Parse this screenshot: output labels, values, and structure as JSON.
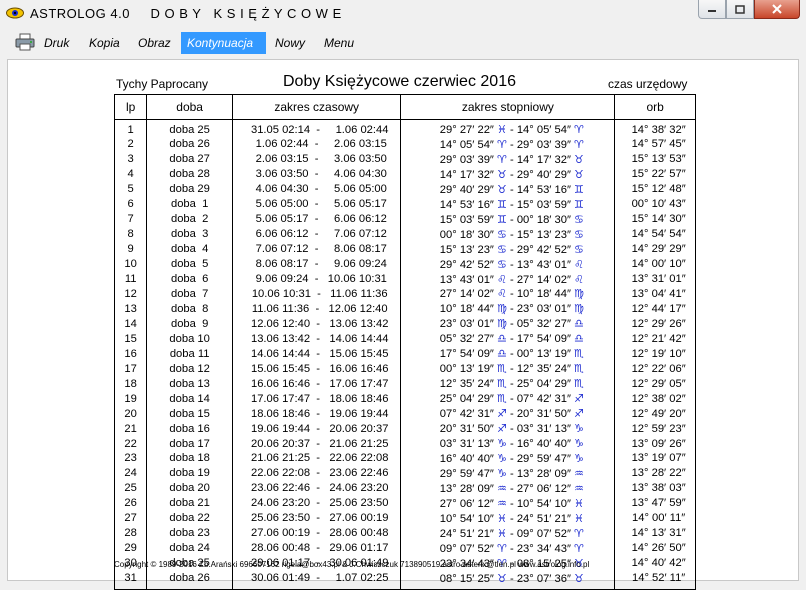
{
  "window": {
    "title": "ASTROLOG 4.0     D O B Y   K S I Ę Ż Y C O W E"
  },
  "menu": [
    "Druk",
    "Kopia",
    "Obraz",
    "Kontynuacja",
    "Nowy",
    "Menu"
  ],
  "active_menu": "Kontynuacja",
  "header": {
    "location": "Tychy Paprocany",
    "title": "Doby Księżycowe   czerwiec 2016",
    "timezone": "czas urzędowy"
  },
  "columns": {
    "lp": "lp",
    "doba": "doba",
    "time": "zakres czasowy",
    "deg": "zakres stopniowy",
    "orb": "orb"
  },
  "accent_color": "#3399ff",
  "rows": [
    {
      "lp": "1",
      "doba": "doba 25",
      "time": "31.05 02:14  -     1.06 02:44",
      "deg": "29° 27′ 22″",
      "s1": "♓",
      "deg2": "14° 05′ 54″",
      "s2": "♈",
      "orb": "14° 38′ 32″"
    },
    {
      "lp": "2",
      "doba": "doba 26",
      "time": " 1.06 02:44  -     2.06 03:15",
      "deg": "14° 05′ 54″",
      "s1": "♈",
      "deg2": "29° 03′ 39″",
      "s2": "♈",
      "orb": "14° 57′ 45″"
    },
    {
      "lp": "3",
      "doba": "doba 27",
      "time": " 2.06 03:15  -     3.06 03:50",
      "deg": "29° 03′ 39″",
      "s1": "♈",
      "deg2": "14° 17′ 32″",
      "s2": "♉",
      "orb": "15° 13′ 53″"
    },
    {
      "lp": "4",
      "doba": "doba 28",
      "time": " 3.06 03:50  -     4.06 04:30",
      "deg": "14° 17′ 32″",
      "s1": "♉",
      "deg2": "29° 40′ 29″",
      "s2": "♉",
      "orb": "15° 22′ 57″"
    },
    {
      "lp": "5",
      "doba": "doba 29",
      "time": " 4.06 04:30  -     5.06 05:00",
      "deg": "29° 40′ 29″",
      "s1": "♉",
      "deg2": "14° 53′ 16″",
      "s2": "♊",
      "orb": "15° 12′ 48″"
    },
    {
      "lp": "6",
      "doba": "doba  1",
      "time": " 5.06 05:00  -     5.06 05:17",
      "deg": "14° 53′ 16″",
      "s1": "♊",
      "deg2": "15° 03′ 59″",
      "s2": "♊",
      "orb": "00° 10′ 43″"
    },
    {
      "lp": "7",
      "doba": "doba  2",
      "time": " 5.06 05:17  -     6.06 06:12",
      "deg": "15° 03′ 59″",
      "s1": "♊",
      "deg2": "00° 18′ 30″",
      "s2": "♋",
      "orb": "15° 14′ 30″"
    },
    {
      "lp": "8",
      "doba": "doba  3",
      "time": " 6.06 06:12  -     7.06 07:12",
      "deg": "00° 18′ 30″",
      "s1": "♋",
      "deg2": "15° 13′ 23″",
      "s2": "♋",
      "orb": "14° 54′ 54″"
    },
    {
      "lp": "9",
      "doba": "doba  4",
      "time": " 7.06 07:12  -     8.06 08:17",
      "deg": "15° 13′ 23″",
      "s1": "♋",
      "deg2": "29° 42′ 52″",
      "s2": "♋",
      "orb": "14° 29′ 29″"
    },
    {
      "lp": "10",
      "doba": "doba  5",
      "time": " 8.06 08:17  -     9.06 09:24",
      "deg": "29° 42′ 52″",
      "s1": "♋",
      "deg2": "13° 43′ 01″",
      "s2": "♌",
      "orb": "14° 00′ 10″"
    },
    {
      "lp": "11",
      "doba": "doba  6",
      "time": " 9.06 09:24  -   10.06 10:31",
      "deg": "13° 43′ 01″",
      "s1": "♌",
      "deg2": "27° 14′ 02″",
      "s2": "♌",
      "orb": "13° 31′ 01″"
    },
    {
      "lp": "12",
      "doba": "doba  7",
      "time": "10.06 10:31  -   11.06 11:36",
      "deg": "27° 14′ 02″",
      "s1": "♌",
      "deg2": "10° 18′ 44″",
      "s2": "♍",
      "orb": "13° 04′ 41″"
    },
    {
      "lp": "13",
      "doba": "doba  8",
      "time": "11.06 11:36  -   12.06 12:40",
      "deg": "10° 18′ 44″",
      "s1": "♍",
      "deg2": "23° 03′ 01″",
      "s2": "♍",
      "orb": "12° 44′ 17″"
    },
    {
      "lp": "14",
      "doba": "doba  9",
      "time": "12.06 12:40  -   13.06 13:42",
      "deg": "23° 03′ 01″",
      "s1": "♍",
      "deg2": "05° 32′ 27″",
      "s2": "♎",
      "orb": "12° 29′ 26″"
    },
    {
      "lp": "15",
      "doba": "doba 10",
      "time": "13.06 13:42  -   14.06 14:44",
      "deg": "05° 32′ 27″",
      "s1": "♎",
      "deg2": "17° 54′ 09″",
      "s2": "♎",
      "orb": "12° 21′ 42″"
    },
    {
      "lp": "16",
      "doba": "doba 11",
      "time": "14.06 14:44  -   15.06 15:45",
      "deg": "17° 54′ 09″",
      "s1": "♎",
      "deg2": "00° 13′ 19″",
      "s2": "♏",
      "orb": "12° 19′ 10″"
    },
    {
      "lp": "17",
      "doba": "doba 12",
      "time": "15.06 15:45  -   16.06 16:46",
      "deg": "00° 13′ 19″",
      "s1": "♏",
      "deg2": "12° 35′ 24″",
      "s2": "♏",
      "orb": "12° 22′ 06″"
    },
    {
      "lp": "18",
      "doba": "doba 13",
      "time": "16.06 16:46  -   17.06 17:47",
      "deg": "12° 35′ 24″",
      "s1": "♏",
      "deg2": "25° 04′ 29″",
      "s2": "♏",
      "orb": "12° 29′ 05″"
    },
    {
      "lp": "19",
      "doba": "doba 14",
      "time": "17.06 17:47  -   18.06 18:46",
      "deg": "25° 04′ 29″",
      "s1": "♏",
      "deg2": "07° 42′ 31″",
      "s2": "♐",
      "orb": "12° 38′ 02″"
    },
    {
      "lp": "20",
      "doba": "doba 15",
      "time": "18.06 18:46  -   19.06 19:44",
      "deg": "07° 42′ 31″",
      "s1": "♐",
      "deg2": "20° 31′ 50″",
      "s2": "♐",
      "orb": "12° 49′ 20″"
    },
    {
      "lp": "21",
      "doba": "doba 16",
      "time": "19.06 19:44  -   20.06 20:37",
      "deg": "20° 31′ 50″",
      "s1": "♐",
      "deg2": "03° 31′ 13″",
      "s2": "♑",
      "orb": "12° 59′ 23″"
    },
    {
      "lp": "22",
      "doba": "doba 17",
      "time": "20.06 20:37  -   21.06 21:25",
      "deg": "03° 31′ 13″",
      "s1": "♑",
      "deg2": "16° 40′ 40″",
      "s2": "♑",
      "orb": "13° 09′ 26″"
    },
    {
      "lp": "23",
      "doba": "doba 18",
      "time": "21.06 21:25  -   22.06 22:08",
      "deg": "16° 40′ 40″",
      "s1": "♑",
      "deg2": "29° 59′ 47″",
      "s2": "♑",
      "orb": "13° 19′ 07″"
    },
    {
      "lp": "24",
      "doba": "doba 19",
      "time": "22.06 22:08  -   23.06 22:46",
      "deg": "29° 59′ 47″",
      "s1": "♑",
      "deg2": "13° 28′ 09″",
      "s2": "♒",
      "orb": "13° 28′ 22″"
    },
    {
      "lp": "25",
      "doba": "doba 20",
      "time": "23.06 22:46  -   24.06 23:20",
      "deg": "13° 28′ 09″",
      "s1": "♒",
      "deg2": "27° 06′ 12″",
      "s2": "♒",
      "orb": "13° 38′ 03″"
    },
    {
      "lp": "26",
      "doba": "doba 21",
      "time": "24.06 23:20  -   25.06 23:50",
      "deg": "27° 06′ 12″",
      "s1": "♒",
      "deg2": "10° 54′ 10″",
      "s2": "♓",
      "orb": "13° 47′ 59″"
    },
    {
      "lp": "27",
      "doba": "doba 22",
      "time": "25.06 23:50  -   27.06 00:19",
      "deg": "10° 54′ 10″",
      "s1": "♓",
      "deg2": "24° 51′ 21″",
      "s2": "♓",
      "orb": "14° 00′ 11″"
    },
    {
      "lp": "28",
      "doba": "doba 23",
      "time": "27.06 00:19  -   28.06 00:48",
      "deg": "24° 51′ 21″",
      "s1": "♓",
      "deg2": "09° 07′ 52″",
      "s2": "♈",
      "orb": "14° 13′ 31″"
    },
    {
      "lp": "29",
      "doba": "doba 24",
      "time": "28.06 00:48  -   29.06 01:17",
      "deg": "09° 07′ 52″",
      "s1": "♈",
      "deg2": "23° 34′ 43″",
      "s2": "♈",
      "orb": "14° 26′ 50″"
    },
    {
      "lp": "30",
      "doba": "doba 25",
      "time": "29.06 01:17  -   30.06 01:49",
      "deg": "23° 34′ 43″",
      "s1": "♈",
      "deg2": "08° 15′ 25″",
      "s2": "♉",
      "orb": "14° 40′ 42″"
    },
    {
      "lp": "31",
      "doba": "doba 26",
      "time": "30.06 01:49  -     1.07 02:25",
      "deg": "08° 15′ 25″",
      "s1": "♉",
      "deg2": "23° 07′ 36″",
      "s2": "♉",
      "orb": "14° 52′ 11″"
    }
  ],
  "footer": "Copyright © 1989-2016 Zb.Arański 696607162 rigela@box43.pl & J.Chwiszczuk 713890519 astro-asterix@tlen.pl www.astrolog.info.pl"
}
